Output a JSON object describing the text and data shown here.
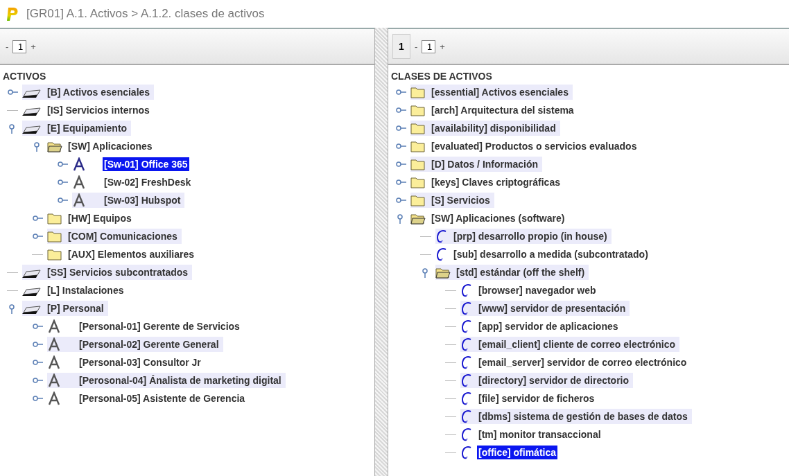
{
  "window": {
    "title": "[GR01] A.1. Activos > A.1.2. clases de activos"
  },
  "left_panel": {
    "toolbar": {
      "decrement": "-",
      "page": "1",
      "increment": "+"
    },
    "header": "ACTIVOS",
    "tree": [
      {
        "label": "[B] Activos esenciales",
        "kind": "asset",
        "expandable": true,
        "expanded": false,
        "marked": true,
        "selected": false
      },
      {
        "label": "[IS] Servicios internos",
        "kind": "asset",
        "expandable": false,
        "expanded": false,
        "marked": false,
        "selected": false
      },
      {
        "label": "[E] Equipamiento",
        "kind": "asset",
        "expandable": true,
        "expanded": true,
        "marked": true,
        "selected": false,
        "children": [
          {
            "label": "[SW] Aplicaciones",
            "kind": "folder",
            "expandable": true,
            "expanded": true,
            "marked": false,
            "selected": false,
            "children": [
              {
                "label": "[Sw-01] Office 365",
                "kind": "person",
                "expandable": true,
                "expanded": false,
                "marked": false,
                "selected": true
              },
              {
                "label": "[Sw-02] FreshDesk",
                "kind": "person",
                "expandable": true,
                "expanded": false,
                "marked": false,
                "selected": false
              },
              {
                "label": "[Sw-03] Hubspot",
                "kind": "person",
                "expandable": true,
                "expanded": false,
                "marked": true,
                "selected": false
              }
            ]
          },
          {
            "label": "[HW] Equipos",
            "kind": "folder",
            "expandable": true,
            "expanded": false,
            "marked": false,
            "selected": false
          },
          {
            "label": "[COM] Comunicaciones",
            "kind": "folder",
            "expandable": true,
            "expanded": false,
            "marked": true,
            "selected": false
          },
          {
            "label": "[AUX] Elementos auxiliares",
            "kind": "folder",
            "expandable": false,
            "expanded": false,
            "marked": false,
            "selected": false
          }
        ]
      },
      {
        "label": "[SS] Servicios subcontratados",
        "kind": "asset",
        "expandable": false,
        "expanded": false,
        "marked": true,
        "selected": false
      },
      {
        "label": "[L] Instalaciones",
        "kind": "asset",
        "expandable": false,
        "expanded": false,
        "marked": false,
        "selected": false
      },
      {
        "label": "[P] Personal",
        "kind": "asset",
        "expandable": true,
        "expanded": true,
        "marked": true,
        "selected": false,
        "children": [
          {
            "label": "[Personal-01] Gerente de Servicios",
            "kind": "person",
            "expandable": true,
            "expanded": false,
            "marked": false,
            "selected": false
          },
          {
            "label": "[Personal-02] Gerente General",
            "kind": "person",
            "expandable": true,
            "expanded": false,
            "marked": true,
            "selected": false
          },
          {
            "label": "[Personal-03] Consultor Jr",
            "kind": "person",
            "expandable": true,
            "expanded": false,
            "marked": false,
            "selected": false
          },
          {
            "label": "[Perosonal-04] Ánalista de marketing digital",
            "kind": "person",
            "expandable": true,
            "expanded": false,
            "marked": true,
            "selected": false
          },
          {
            "label": "[Personal-05] Asistente de Gerencia",
            "kind": "person",
            "expandable": true,
            "expanded": false,
            "marked": false,
            "selected": false
          }
        ]
      }
    ]
  },
  "right_panel": {
    "toolbar": {
      "page_button": "1",
      "decrement": "-",
      "page": "1",
      "increment": "+"
    },
    "header": "CLASES DE ACTIVOS",
    "tree": [
      {
        "label": "[essential] Activos esenciales",
        "kind": "folder",
        "expandable": true,
        "expanded": false,
        "marked": true,
        "selected": false
      },
      {
        "label": "[arch] Arquitectura del sistema",
        "kind": "folder",
        "expandable": true,
        "expanded": false,
        "marked": false,
        "selected": false
      },
      {
        "label": "[availability] disponibilidad",
        "kind": "folder",
        "expandable": true,
        "expanded": false,
        "marked": true,
        "selected": false
      },
      {
        "label": "[evaluated] Productos o servicios evaluados",
        "kind": "folder",
        "expandable": true,
        "expanded": false,
        "marked": false,
        "selected": false
      },
      {
        "label": "[D] Datos / Información",
        "kind": "folder",
        "expandable": true,
        "expanded": false,
        "marked": true,
        "selected": false
      },
      {
        "label": "[keys] Claves criptográficas",
        "kind": "folder",
        "expandable": true,
        "expanded": false,
        "marked": false,
        "selected": false
      },
      {
        "label": "[S] Servicios",
        "kind": "folder",
        "expandable": true,
        "expanded": false,
        "marked": true,
        "selected": false
      },
      {
        "label": "[SW] Aplicaciones (software)",
        "kind": "folder",
        "expandable": true,
        "expanded": true,
        "marked": false,
        "selected": false,
        "children": [
          {
            "label": "[prp] desarrollo propio (in house)",
            "kind": "class",
            "expandable": false,
            "expanded": false,
            "marked": true,
            "selected": false
          },
          {
            "label": "[sub] desarrollo a medida (subcontratado)",
            "kind": "class",
            "expandable": false,
            "expanded": false,
            "marked": false,
            "selected": false
          },
          {
            "label": "[std] estándar (off the shelf)",
            "kind": "folder",
            "expandable": true,
            "expanded": true,
            "marked": true,
            "selected": false,
            "children": [
              {
                "label": "[browser] navegador web",
                "kind": "class",
                "expandable": false,
                "expanded": false,
                "marked": false,
                "selected": false
              },
              {
                "label": "[www] servidor de presentación",
                "kind": "class",
                "expandable": false,
                "expanded": false,
                "marked": true,
                "selected": false
              },
              {
                "label": "[app] servidor de aplicaciones",
                "kind": "class",
                "expandable": false,
                "expanded": false,
                "marked": false,
                "selected": false
              },
              {
                "label": "[email_client] cliente de correo electrónico",
                "kind": "class",
                "expandable": false,
                "expanded": false,
                "marked": true,
                "selected": false
              },
              {
                "label": "[email_server] servidor de correo electrónico",
                "kind": "class",
                "expandable": false,
                "expanded": false,
                "marked": false,
                "selected": false
              },
              {
                "label": "[directory] servidor de directorio",
                "kind": "class",
                "expandable": false,
                "expanded": false,
                "marked": true,
                "selected": false
              },
              {
                "label": "[file] servidor de ficheros",
                "kind": "class",
                "expandable": false,
                "expanded": false,
                "marked": false,
                "selected": false
              },
              {
                "label": "[dbms] sistema de gestión de bases de datos",
                "kind": "class",
                "expandable": false,
                "expanded": false,
                "marked": true,
                "selected": false
              },
              {
                "label": "[tm] monitor transaccional",
                "kind": "class",
                "expandable": false,
                "expanded": false,
                "marked": false,
                "selected": false
              },
              {
                "label": "[office] ofimática",
                "kind": "class",
                "expandable": false,
                "expanded": false,
                "marked": false,
                "selected": true
              }
            ]
          }
        ]
      }
    ]
  }
}
